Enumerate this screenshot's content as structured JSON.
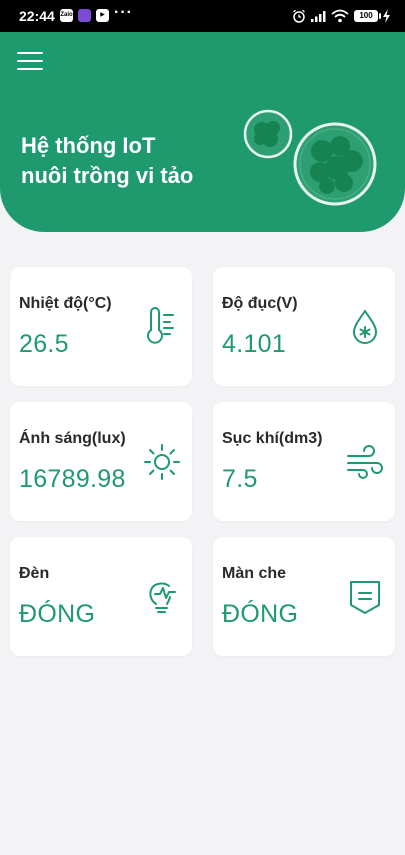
{
  "status_bar": {
    "time": "22:44",
    "battery": "100",
    "apps": [
      "Zalo",
      "",
      ""
    ],
    "more": "···"
  },
  "header": {
    "title_line1": "Hệ thống IoT",
    "title_line2": "nuôi trồng vi tảo",
    "background_color": "#1f9a6e",
    "menu_icon": "hamburger-menu-icon"
  },
  "cards": [
    {
      "label": "Nhiệt độ(°C)",
      "value": "26.5",
      "icon": "thermometer-icon"
    },
    {
      "label": "Độ đục(V)",
      "value": "4.101",
      "icon": "water-drop-icon"
    },
    {
      "label": "Ánh sáng(lux)",
      "value": "16789.98",
      "icon": "sun-icon"
    },
    {
      "label": "Sục khí(dm3)",
      "value": "7.5",
      "icon": "wind-icon"
    },
    {
      "label": "Đèn",
      "value": "ĐÓNG",
      "icon": "lightbulb-icon"
    },
    {
      "label": "Màn che",
      "value": "ĐÓNG",
      "icon": "shield-icon"
    }
  ],
  "accent_color": "#1f9a6e"
}
